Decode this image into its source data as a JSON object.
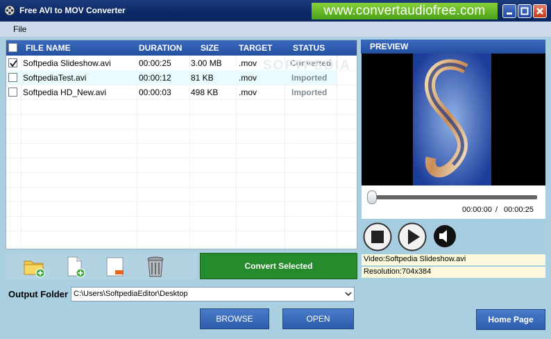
{
  "window": {
    "title": "Free AVI to MOV Converter",
    "banner": "www.convertaudiofree.com"
  },
  "menu": {
    "file": "File"
  },
  "file_list": {
    "columns": [
      "FILE NAME",
      "DURATION",
      "SIZE",
      "TARGET",
      "STATUS"
    ],
    "watermark": "SOFTPEDIA",
    "rows": [
      {
        "checked": true,
        "name": "Softpedia Slideshow.avi",
        "duration": "00:00:25",
        "size": "3.00 MB",
        "target": ".mov",
        "status": "Converted"
      },
      {
        "checked": false,
        "name": "SoftpediaTest.avi",
        "duration": "00:00:12",
        "size": "81 KB",
        "target": ".mov",
        "status": "Imported"
      },
      {
        "checked": false,
        "name": "Softpedia HD_New.avi",
        "duration": "00:00:03",
        "size": "498 KB",
        "target": ".mov",
        "status": "Imported"
      }
    ]
  },
  "toolbar": {
    "icons": [
      "add-folder-icon",
      "add-file-icon",
      "remove-file-icon",
      "trash-icon"
    ],
    "convert_label": "Convert Selected"
  },
  "output": {
    "label": "Output Folder",
    "path": "C:\\Users\\SoftpediaEditor\\Desktop",
    "browse_label": "BROWSE",
    "open_label": "OPEN"
  },
  "preview": {
    "header": "PREVIEW",
    "current_time": "00:00:00",
    "separator": "/",
    "total_time": "00:00:25",
    "seek_position": 0,
    "video_info": "Video:Softpedia Slideshow.avi",
    "resolution_info": "Resolution:704x384",
    "controls": [
      "stop-icon",
      "play-icon",
      "volume-icon"
    ]
  },
  "home_label": "Home Page",
  "colors": {
    "titlebar": "#0d2a66",
    "banner": "#5ab41f",
    "convert": "#258b2c",
    "header": "#2d5cab"
  }
}
